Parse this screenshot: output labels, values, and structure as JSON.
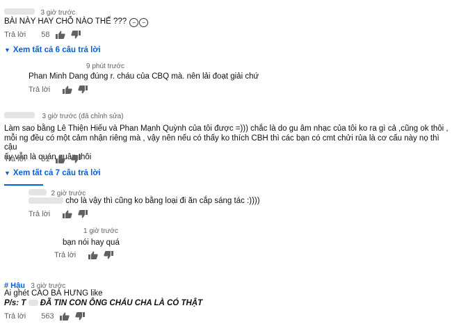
{
  "comments": [
    {
      "time": "3 giờ trước",
      "text": "BÀI NÀY HAY CHỖ NÀO THẾ ???",
      "emoji": "😑😑",
      "reply_label": "Trả lời",
      "likes": "58",
      "view_replies": "Xem tất cả 6 câu trả lời"
    },
    {
      "time": "3 giờ trước (đã chỉnh sửa)",
      "text_lines": [
        "Làm sao bằng Lê Thiện Hiếu và Phan Mạnh Quỳnh của tôi được =))) chắc là do gu âm nhạc của tôi ko ra gì cả ,cũng ok thôi ,",
        "mỗi ng đều có một cảm nhận riêng mà , vậy nên nếu có thấy ko thích CBH thì các bạn có cmt chửi rủa là cơ cấu này nọ thì cậu",
        "ấy vẫn là quán quân thôi"
      ],
      "reply_label": "Trả lời",
      "likes": "61",
      "view_replies": "Xem tất cả 7 câu trả lời"
    },
    {
      "author": "# Hậu",
      "time": "3 giờ trước",
      "line1": "Ai ghét CAO BÁ HƯNG like",
      "line2_prefix": "P/s: T",
      "line2_rest": "ĐÃ TIN CON ÔNG CHÁU CHA LÀ CÓ THẬT",
      "reply_label": "Trả lời",
      "likes": "563"
    }
  ],
  "replies": [
    {
      "time": "9 phút trước",
      "text": "Phan Minh Dang đúng r. cháu của CBQ mà. nên lải đoạt giải chứ",
      "reply_label": "Trả lời"
    },
    {
      "time": "2 giờ trước",
      "text": "cho là vậy thì cũng ko bằng loại đi ăn cắp sáng tác :))))",
      "reply_label": "Trả lời"
    },
    {
      "time": "1 giờ trước",
      "text": "bạn nói hay quá",
      "reply_label": "Trả lời"
    }
  ],
  "colors": {
    "link": "#065fd4",
    "meta": "#606060",
    "text": "#0f0f0f"
  }
}
